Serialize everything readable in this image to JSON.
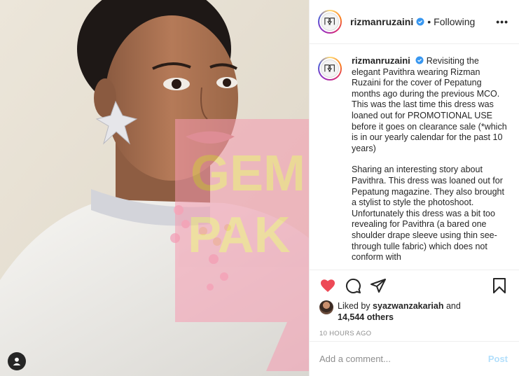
{
  "header": {
    "username": "rizmanruzaini",
    "separator": "•",
    "follow_state": "Following",
    "more_label": "•••",
    "verified_icon": "verified-badge-icon"
  },
  "caption": {
    "username": "rizmanruzaini",
    "paragraph_1": "Revisiting the elegant Pavithra wearing Rizman Ruzaini for the cover of Pepatung months ago during the previous MCO. This was the last time this dress was loaned out for PROMOTIONAL USE before it goes on clearance sale (*which is in our yearly calendar for the past 10 years)",
    "paragraph_2": "Sharing an interesting story about Pavithra. This dress was loaned out for Pepatung magazine. They also brought a stylist to style the photoshoot. Unfortunately this dress was a bit too revealing for Pavithra (a bared one shoulder drape sleeve using thin see-through tulle fabric) which does not conform with"
  },
  "photo": {
    "watermark_line_1": "GEM",
    "watermark_line_2": "PAK",
    "watermark_color": "#f7a8b8",
    "user_tag_icon": "user-tag-icon"
  },
  "actions": {
    "like_icon": "heart-filled-icon",
    "comment_icon": "comment-icon",
    "share_icon": "share-icon",
    "save_icon": "bookmark-icon",
    "liked_color": "#ed4956"
  },
  "likes": {
    "prefix": "Liked by",
    "liker": "syazwanzakariah",
    "connector": "and",
    "others": "14,544 others"
  },
  "timestamp": "10 HOURS AGO",
  "add_comment": {
    "placeholder": "Add a comment...",
    "post_label": "Post"
  },
  "colors": {
    "accent_blue": "#0095f6",
    "post_disabled": "#b2dffc",
    "muted": "#8e8e8e",
    "text": "#262626"
  }
}
